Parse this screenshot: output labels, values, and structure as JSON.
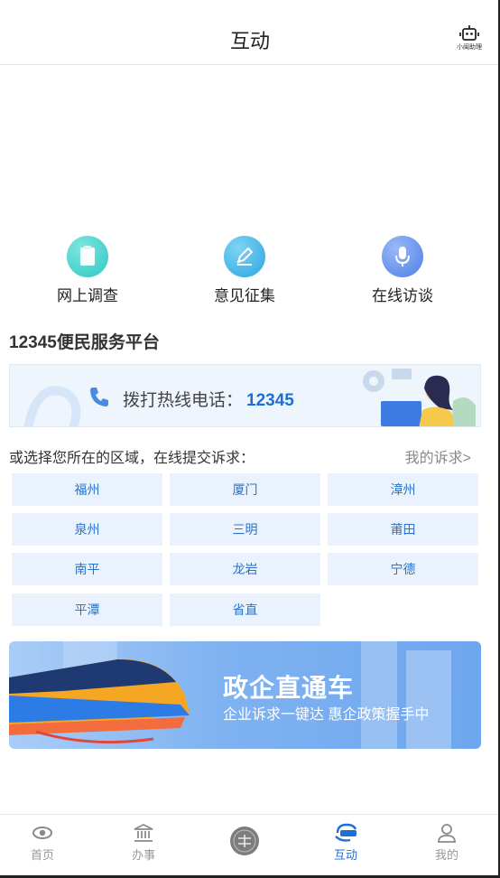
{
  "header": {
    "title": "互动",
    "robot_label": "小闽助理"
  },
  "quick_actions": [
    {
      "label": "网上调查",
      "icon": "survey-icon",
      "color": "#2fc7c3"
    },
    {
      "label": "意见征集",
      "icon": "pen-icon",
      "color": "#2aa6e0"
    },
    {
      "label": "在线访谈",
      "icon": "microphone-icon",
      "color": "#4d7fe6"
    }
  ],
  "service": {
    "title": "12345便民服务平台",
    "hotline_label": "拨打热线电话：",
    "hotline_number": "12345"
  },
  "regions": {
    "prompt": "或选择您所在的区域，在线提交诉求：",
    "my_appeals": "我的诉求>",
    "items": [
      "福州",
      "厦门",
      "漳州",
      "泉州",
      "三明",
      "莆田",
      "南平",
      "龙岩",
      "宁德",
      "平潭",
      "省直"
    ]
  },
  "banner": {
    "title": "政企直通车",
    "subtitle": "企业诉求一键达 惠企政策握手中"
  },
  "tabbar": {
    "items": [
      {
        "label": "首页",
        "icon": "eye-icon"
      },
      {
        "label": "办事",
        "icon": "government-building-icon"
      },
      {
        "label": "",
        "icon": "fujian-emblem-icon"
      },
      {
        "label": "互动",
        "icon": "hotline-12345-icon",
        "active": true
      },
      {
        "label": "我的",
        "icon": "user-icon"
      }
    ]
  },
  "colors": {
    "accent": "#1d6fd6",
    "cell_bg": "#eaf3fd",
    "cell_text": "#2a73c9"
  }
}
